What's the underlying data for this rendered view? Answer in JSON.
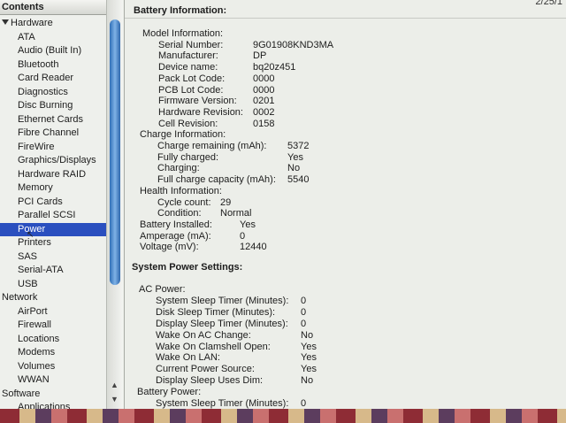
{
  "sidebar": {
    "header": "Contents",
    "rows": [
      {
        "label": "Hardware",
        "type": "cat",
        "expanded": true
      },
      {
        "label": "ATA",
        "type": "item"
      },
      {
        "label": "Audio (Built In)",
        "type": "item"
      },
      {
        "label": "Bluetooth",
        "type": "item"
      },
      {
        "label": "Card Reader",
        "type": "item"
      },
      {
        "label": "Diagnostics",
        "type": "item"
      },
      {
        "label": "Disc Burning",
        "type": "item"
      },
      {
        "label": "Ethernet Cards",
        "type": "item"
      },
      {
        "label": "Fibre Channel",
        "type": "item"
      },
      {
        "label": "FireWire",
        "type": "item"
      },
      {
        "label": "Graphics/Displays",
        "type": "item"
      },
      {
        "label": "Hardware RAID",
        "type": "item"
      },
      {
        "label": "Memory",
        "type": "item"
      },
      {
        "label": "PCI Cards",
        "type": "item"
      },
      {
        "label": "Parallel SCSI",
        "type": "item"
      },
      {
        "label": "Power",
        "type": "item",
        "selected": true
      },
      {
        "label": "Printers",
        "type": "item"
      },
      {
        "label": "SAS",
        "type": "item"
      },
      {
        "label": "Serial-ATA",
        "type": "item"
      },
      {
        "label": "USB",
        "type": "item"
      },
      {
        "label": "Network",
        "type": "cat"
      },
      {
        "label": "AirPort",
        "type": "item"
      },
      {
        "label": "Firewall",
        "type": "item"
      },
      {
        "label": "Locations",
        "type": "item"
      },
      {
        "label": "Modems",
        "type": "item"
      },
      {
        "label": "Volumes",
        "type": "item"
      },
      {
        "label": "WWAN",
        "type": "item"
      },
      {
        "label": "Software",
        "type": "cat"
      },
      {
        "label": "Applications",
        "type": "item"
      }
    ]
  },
  "detail": {
    "date_fragment": "2/25/1",
    "battery_title": "Battery Information:",
    "model_heading": "Model Information:",
    "model": [
      {
        "label": "Serial Number:",
        "value": "9G01908KND3MA"
      },
      {
        "label": "Manufacturer:",
        "value": "DP"
      },
      {
        "label": "Device name:",
        "value": "bq20z451"
      },
      {
        "label": "Pack Lot Code:",
        "value": "0000"
      },
      {
        "label": "PCB Lot Code:",
        "value": "0000"
      },
      {
        "label": "Firmware Version:",
        "value": "0201"
      },
      {
        "label": "Hardware Revision:",
        "value": "0002"
      },
      {
        "label": "Cell Revision:",
        "value": "0158"
      }
    ],
    "charge_heading": "Charge Information:",
    "charge": [
      {
        "label": "Charge remaining (mAh):",
        "value": "5372"
      },
      {
        "label": "Fully charged:",
        "value": "Yes"
      },
      {
        "label": "Charging:",
        "value": "No"
      },
      {
        "label": "Full charge capacity (mAh):",
        "value": "5540"
      }
    ],
    "health_heading": "Health Information:",
    "health": [
      {
        "label": "Cycle count:",
        "value": "29"
      },
      {
        "label": "Condition:",
        "value": "Normal"
      }
    ],
    "battery_misc": [
      {
        "label": "Battery Installed:",
        "value": "Yes"
      },
      {
        "label": "Amperage (mA):",
        "value": "0"
      },
      {
        "label": "Voltage (mV):",
        "value": "12440"
      }
    ],
    "power_settings_title": "System Power Settings:",
    "ac_heading": "AC Power:",
    "ac": [
      {
        "label": "System Sleep Timer (Minutes):",
        "value": "0"
      },
      {
        "label": "Disk Sleep Timer (Minutes):",
        "value": "0"
      },
      {
        "label": "Display Sleep Timer (Minutes):",
        "value": "0"
      },
      {
        "label": "Wake On AC Change:",
        "value": "No"
      },
      {
        "label": "Wake On Clamshell Open:",
        "value": "Yes"
      },
      {
        "label": "Wake On LAN:",
        "value": "Yes"
      },
      {
        "label": "Current Power Source:",
        "value": "Yes"
      },
      {
        "label": "Display Sleep Uses Dim:",
        "value": "No"
      }
    ],
    "battery_power_heading": "Battery Power:",
    "battery_power": [
      {
        "label": "System Sleep Timer (Minutes):",
        "value": "0"
      }
    ]
  }
}
